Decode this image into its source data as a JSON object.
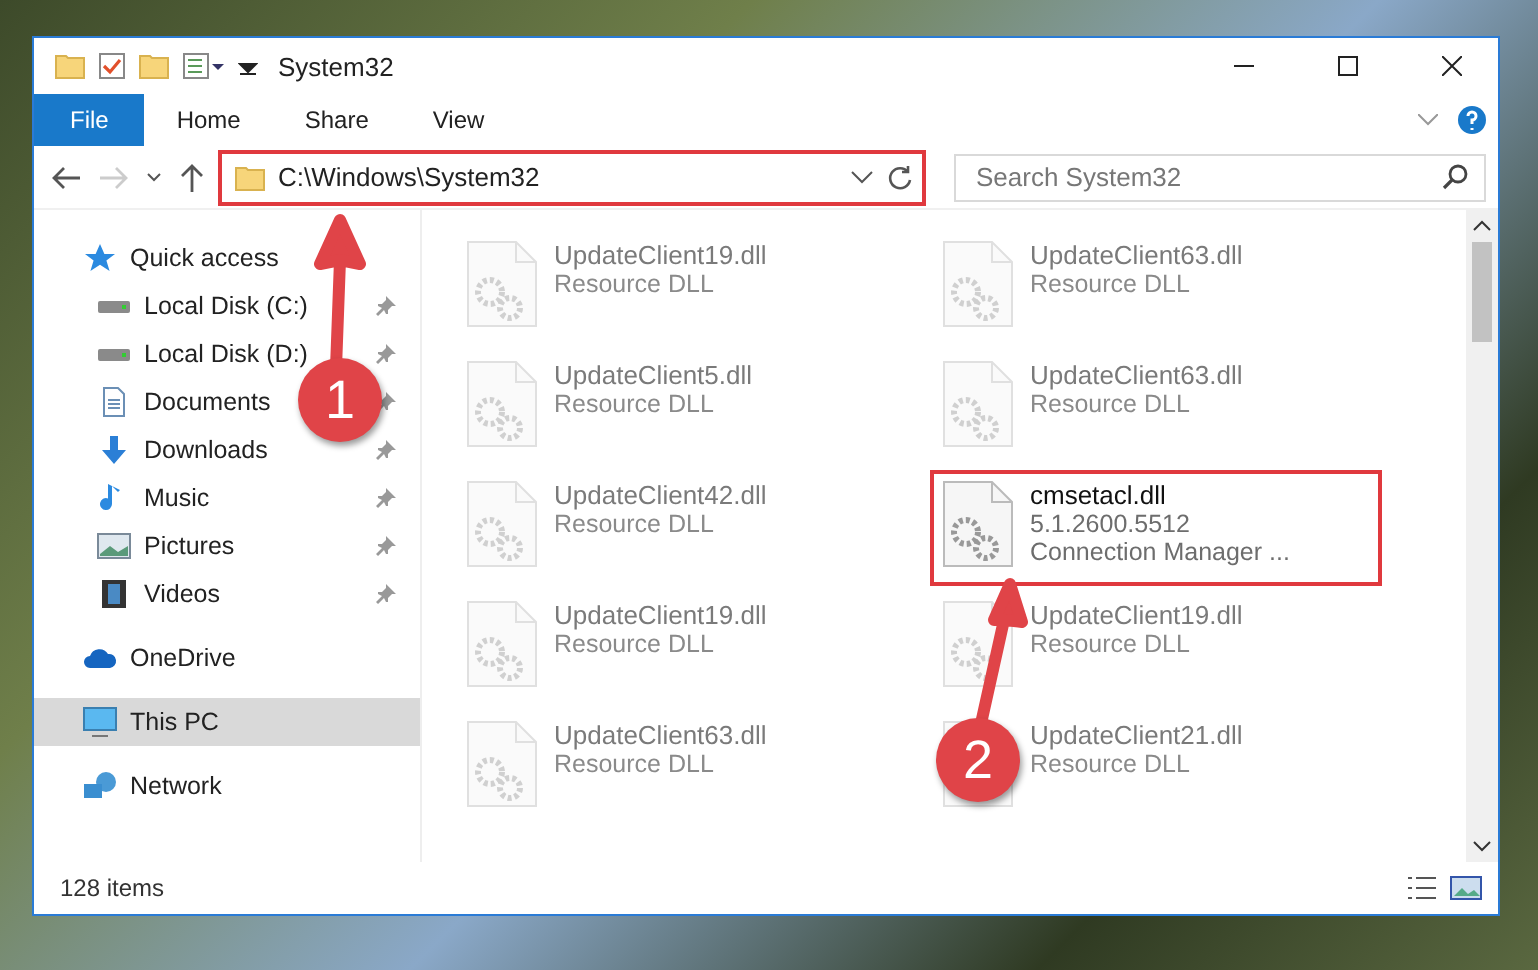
{
  "window": {
    "title": "System32"
  },
  "ribbon_tabs": [
    {
      "label": "File",
      "kind": "file"
    },
    {
      "label": "Home",
      "kind": "tab"
    },
    {
      "label": "Share",
      "kind": "tab"
    },
    {
      "label": "View",
      "kind": "tab"
    }
  ],
  "address": {
    "path": "C:\\Windows\\System32",
    "highlighted": true
  },
  "search": {
    "placeholder": "Search System32"
  },
  "sidebar": {
    "items": [
      {
        "label": "Quick access",
        "kind": "star",
        "selected": false,
        "children": [
          {
            "label": "Local Disk (C:)",
            "kind": "drive",
            "pinned": true,
            "selected": false
          },
          {
            "label": "Local Disk (D:)",
            "kind": "drive",
            "pinned": true,
            "selected": false
          },
          {
            "label": "Documents",
            "kind": "document",
            "pinned": true,
            "selected": false
          },
          {
            "label": "Downloads",
            "kind": "download",
            "pinned": true,
            "selected": false
          },
          {
            "label": "Music",
            "kind": "music",
            "pinned": true,
            "selected": false
          },
          {
            "label": "Pictures",
            "kind": "picture",
            "pinned": true,
            "selected": false
          },
          {
            "label": "Videos",
            "kind": "video",
            "pinned": true,
            "selected": false
          }
        ]
      },
      {
        "label": "OneDrive",
        "kind": "cloud",
        "selected": false
      },
      {
        "label": "This PC",
        "kind": "pc",
        "selected": true
      },
      {
        "label": "Network",
        "kind": "network",
        "selected": false
      }
    ]
  },
  "files": [
    {
      "name": "UpdateClient19.dll",
      "details": [
        "Resource DLL"
      ],
      "blurred": true,
      "highlighted": false
    },
    {
      "name": "UpdateClient63.dll",
      "details": [
        "Resource DLL"
      ],
      "blurred": true,
      "highlighted": false
    },
    {
      "name": "UpdateClient5.dll",
      "details": [
        "Resource DLL"
      ],
      "blurred": true,
      "highlighted": false
    },
    {
      "name": "UpdateClient63.dll",
      "details": [
        "Resource DLL"
      ],
      "blurred": true,
      "highlighted": false
    },
    {
      "name": "UpdateClient42.dll",
      "details": [
        "Resource DLL"
      ],
      "blurred": true,
      "highlighted": false
    },
    {
      "name": "cmsetacl.dll",
      "details": [
        "5.1.2600.5512",
        "Connection Manager ..."
      ],
      "blurred": false,
      "highlighted": true
    },
    {
      "name": "UpdateClient19.dll",
      "details": [
        "Resource DLL"
      ],
      "blurred": true,
      "highlighted": false
    },
    {
      "name": "UpdateClient19.dll",
      "details": [
        "Resource DLL"
      ],
      "blurred": true,
      "highlighted": false
    },
    {
      "name": "UpdateClient63.dll",
      "details": [
        "Resource DLL"
      ],
      "blurred": true,
      "highlighted": false
    },
    {
      "name": "UpdateClient21.dll",
      "details": [
        "Resource DLL"
      ],
      "blurred": true,
      "highlighted": false
    }
  ],
  "status_bar": {
    "count": "128 items"
  },
  "callouts": [
    {
      "label": "1"
    },
    {
      "label": "2"
    }
  ]
}
